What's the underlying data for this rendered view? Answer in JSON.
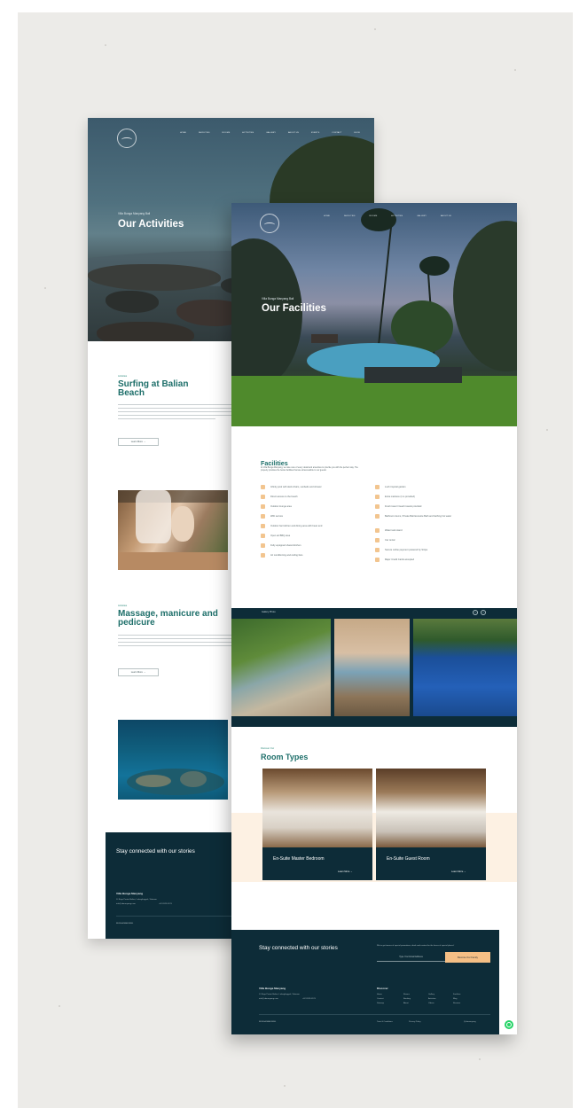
{
  "back_page": {
    "hero": {
      "nav_items": [
        "HOME",
        "FACILITIES",
        "ROOMS",
        "ACTIVITIES",
        "GALLERY",
        "ABOUT US",
        "EVENTS",
        "CONTACT",
        "BOOK"
      ],
      "eyebrow": "Villa Bunga Manyang Bali",
      "title": "Our Activities"
    },
    "activity_1": {
      "eyebrow": "Activities",
      "title": "Surfing at Balian Beach",
      "button": "Learn More →"
    },
    "activity_2": {
      "eyebrow": "Activities",
      "title": "Massage, manicure and pedicure",
      "button": "Learn More →"
    },
    "footer": {
      "title": "Stay connected with our stories",
      "villa_name": "Villa Bunga Manyang",
      "address": "Jl. Raya Pantai Balian, Lalanglinggah, Tabanan",
      "email": "info@vbmanyang.com",
      "phone": "+62 8123 0123",
      "logo_text": "BUNGA MANYANG"
    }
  },
  "front_page": {
    "hero": {
      "nav_items": [
        "HOME",
        "FACILITIES",
        "ROOMS",
        "ACTIVITIES",
        "GALLERY",
        "ABOUT US"
      ],
      "eyebrow": "Villa Bunga Manyang Bali",
      "title": "Our Facilities"
    },
    "facilities": {
      "title": "Facilities",
      "intro": "At Villa Bunga Manyang, we take care of every detail and amenities to provide you with the perfect stay. The property provides the below facilities that are all accessible to our guests:",
      "left_column": [
        "Infinity pool with deck chairs, sunbeds and shower",
        "Direct access to the beach",
        "Outdoor lounge area",
        "WiFi service",
        "Outdoor bar kitchen and dining area with bean and",
        "Open air BBQ area",
        "Fully equipped shared kitchen",
        "Air conditioning and ceiling fans"
      ],
      "right_column": [
        "Lush tropical garden",
        "Extra mattress (1 is provided)",
        "Fresh towel / beach towels provided",
        "Bathroom items, Private Bali Ecosuite Bath and bathing hot water",
        "Water tank stand",
        "Car rental",
        "Secure online payment powered by Stripe",
        "Major Credit Cards accepted"
      ]
    },
    "gallery": {
      "label": "Gallery Photo"
    },
    "room_types": {
      "eyebrow": "Discover Our",
      "title": "Room Types",
      "rooms": [
        {
          "name": "En-Suite Master Bedroom",
          "link": "Learn More →"
        },
        {
          "name": "En-Suite Guest Room",
          "link": "Learn More →"
        }
      ]
    },
    "footer": {
      "title": "Stay connected with our stories",
      "newsletter_note": "We've got tonnes of special promotions, deals and content for the lovers of special places!",
      "email_placeholder": "Type Your Email Address",
      "subscribe_button": "Become Our Family",
      "villa_name": "Villa Bunga Manyang",
      "address": "Jl. Raya Pantai Balian, Lalanglinggah, Tabanan",
      "email": "info@vbmanyang.com",
      "phone": "+62 8123 0123",
      "discover_title": "Discover",
      "discover_links": [
        "Home",
        "Rooms",
        "Gallery",
        "Facilities",
        "Contact",
        "Booking",
        "Activities",
        "Blog",
        "Sitemap",
        "About",
        "Videos",
        "Reviews"
      ],
      "bottom_links": [
        "Term & Conditions",
        "Privacy Policy"
      ],
      "social_handle": "@vbmanyang",
      "logo_text": "BUNGA MANYANG"
    }
  },
  "colors": {
    "teal_heading": "#1e6f6a",
    "navy": "#0d2c38",
    "peach": "#f4bf85",
    "cream_band": "#fdf1e3",
    "icon_peach": "#f2c58f"
  }
}
